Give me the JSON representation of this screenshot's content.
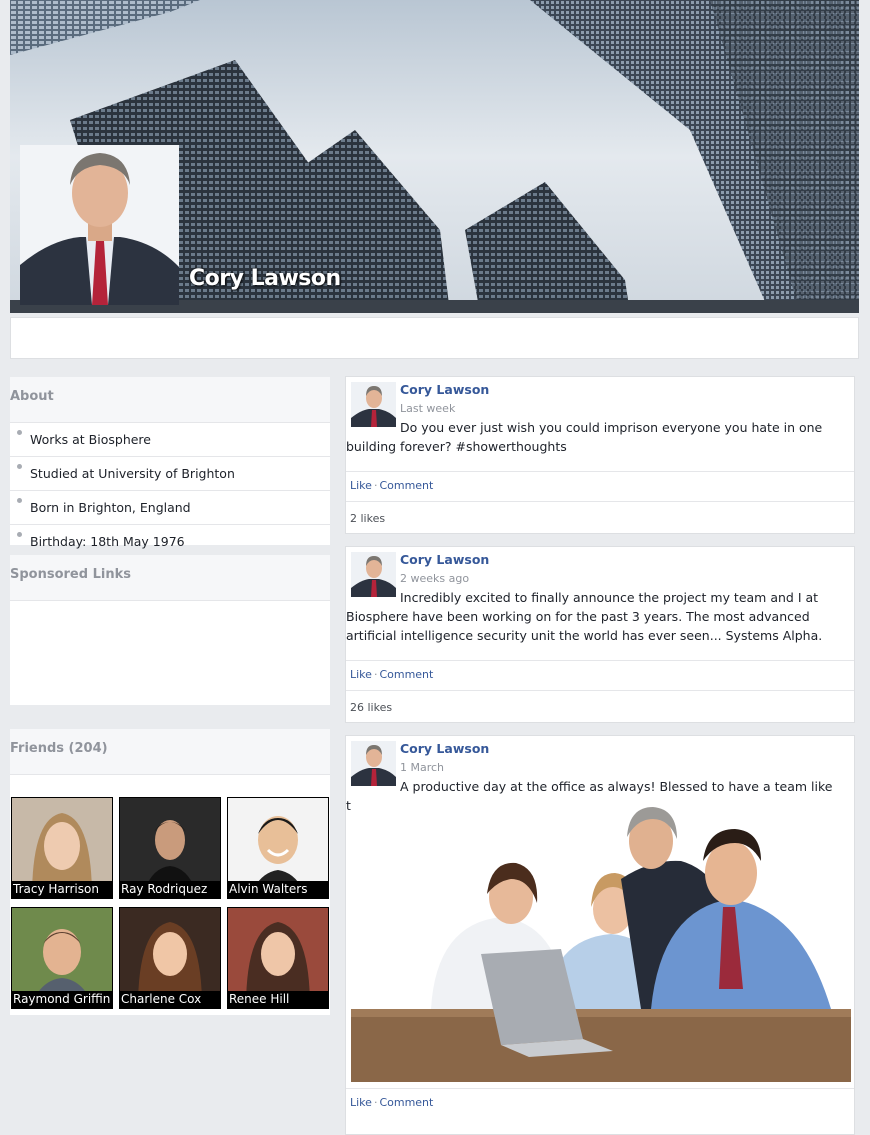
{
  "profile": {
    "name": "Cory Lawson",
    "cover_icon": "skyscrapers-photo",
    "avatar_icon": "man-in-suit-photo"
  },
  "about": {
    "title": "About",
    "items": [
      {
        "label": "Works at Biosphere"
      },
      {
        "label": "Studied at University of Brighton"
      },
      {
        "label": "Born in Brighton, England"
      },
      {
        "label": "Birthday: 18th May 1976"
      }
    ]
  },
  "sponsored": {
    "title": "Sponsored Links"
  },
  "friends": {
    "title": "Friends (204)",
    "list": [
      {
        "name": "Tracy Harrison"
      },
      {
        "name": "Ray Rodriquez"
      },
      {
        "name": "Alvin Walters"
      },
      {
        "name": "Raymond Griffin"
      },
      {
        "name": "Charlene Cox"
      },
      {
        "name": "Renee Hill"
      }
    ]
  },
  "posts": [
    {
      "author": "Cory Lawson",
      "time": "Last week",
      "text": "Do you ever just wish you could imprison everyone you hate in one building forever? #showerthoughts",
      "like_label": "Like",
      "comment_label": "Comment",
      "likes": "2 likes"
    },
    {
      "author": "Cory Lawson",
      "time": "2 weeks ago",
      "text": "Incredibly excited to finally announce the project my team and I at Biosphere have been working on for the past 3 years. The most advanced artificial intelligence security unit the world has ever seen... Systems Alpha.",
      "like_label": "Like",
      "comment_label": "Comment",
      "likes": "26 likes"
    },
    {
      "author": "Cory Lawson",
      "time": "1 March",
      "text": "A productive day at the office as always! Blessed to have a team like this",
      "image_icon": "office-team-photo",
      "like_label": "Like",
      "comment_label": "Comment"
    }
  ],
  "separator": "·"
}
